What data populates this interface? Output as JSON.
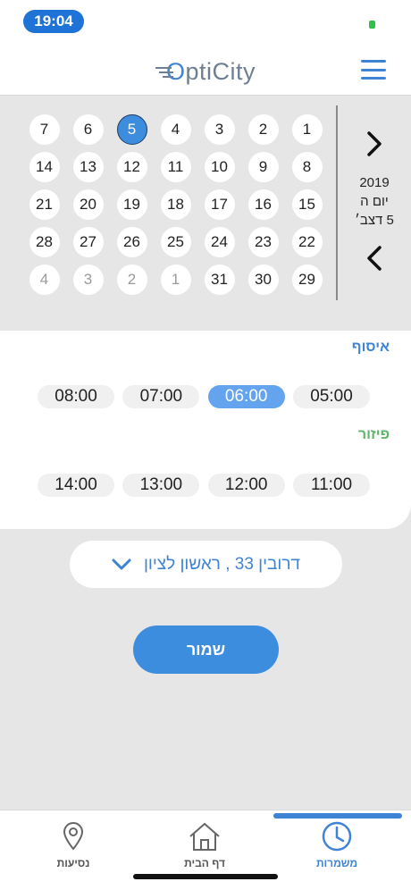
{
  "status_bar": {
    "time": "19:04",
    "battery_color": "#2fc14a"
  },
  "header": {
    "logo_prefix": "O",
    "logo_rest": "ptiCity",
    "menu_icon": "hamburger-menu-icon"
  },
  "calendar": {
    "date_year": "2019",
    "date_day": "יום ה",
    "date_full": "5 דצב׳",
    "days": [
      {
        "label": "1",
        "muted": false
      },
      {
        "label": "2",
        "muted": false
      },
      {
        "label": "3",
        "muted": false
      },
      {
        "label": "4",
        "muted": false
      },
      {
        "label": "5",
        "muted": false,
        "selected": true
      },
      {
        "label": "6",
        "muted": false
      },
      {
        "label": "7",
        "muted": false
      },
      {
        "label": "8",
        "muted": false
      },
      {
        "label": "9",
        "muted": false
      },
      {
        "label": "10",
        "muted": false
      },
      {
        "label": "11",
        "muted": false
      },
      {
        "label": "12",
        "muted": false
      },
      {
        "label": "13",
        "muted": false
      },
      {
        "label": "14",
        "muted": false
      },
      {
        "label": "15",
        "muted": false
      },
      {
        "label": "16",
        "muted": false
      },
      {
        "label": "17",
        "muted": false
      },
      {
        "label": "18",
        "muted": false
      },
      {
        "label": "19",
        "muted": false
      },
      {
        "label": "20",
        "muted": false
      },
      {
        "label": "21",
        "muted": false
      },
      {
        "label": "22",
        "muted": false
      },
      {
        "label": "23",
        "muted": false
      },
      {
        "label": "24",
        "muted": false
      },
      {
        "label": "25",
        "muted": false
      },
      {
        "label": "26",
        "muted": false
      },
      {
        "label": "27",
        "muted": false
      },
      {
        "label": "28",
        "muted": false
      },
      {
        "label": "29",
        "muted": false
      },
      {
        "label": "30",
        "muted": false
      },
      {
        "label": "31",
        "muted": false
      },
      {
        "label": "1",
        "muted": true
      },
      {
        "label": "2",
        "muted": true
      },
      {
        "label": "3",
        "muted": true
      },
      {
        "label": "4",
        "muted": true
      }
    ]
  },
  "pickup": {
    "title": "איסוף",
    "times": [
      {
        "label": "05:00",
        "active": false
      },
      {
        "label": "06:00",
        "active": true
      },
      {
        "label": "07:00",
        "active": false
      },
      {
        "label": "08:00",
        "active": false
      }
    ]
  },
  "distribution": {
    "title": "פיזור",
    "times": [
      {
        "label": "11:00",
        "active": false
      },
      {
        "label": "12:00",
        "active": false
      },
      {
        "label": "13:00",
        "active": false
      },
      {
        "label": "14:00",
        "active": false
      }
    ]
  },
  "address": {
    "value": "דרובין 33 , ראשון לציון"
  },
  "save_label": "שמור",
  "bottom_nav": {
    "trips_label": "נסיעות",
    "home_label": "דף הבית",
    "shifts_label": "משמרות",
    "active": "shifts"
  },
  "colors": {
    "accent": "#3f84d4",
    "selected_day": "#3d8ddf",
    "active_chip": "#64a4ee",
    "distribution_title": "#5db56a"
  }
}
